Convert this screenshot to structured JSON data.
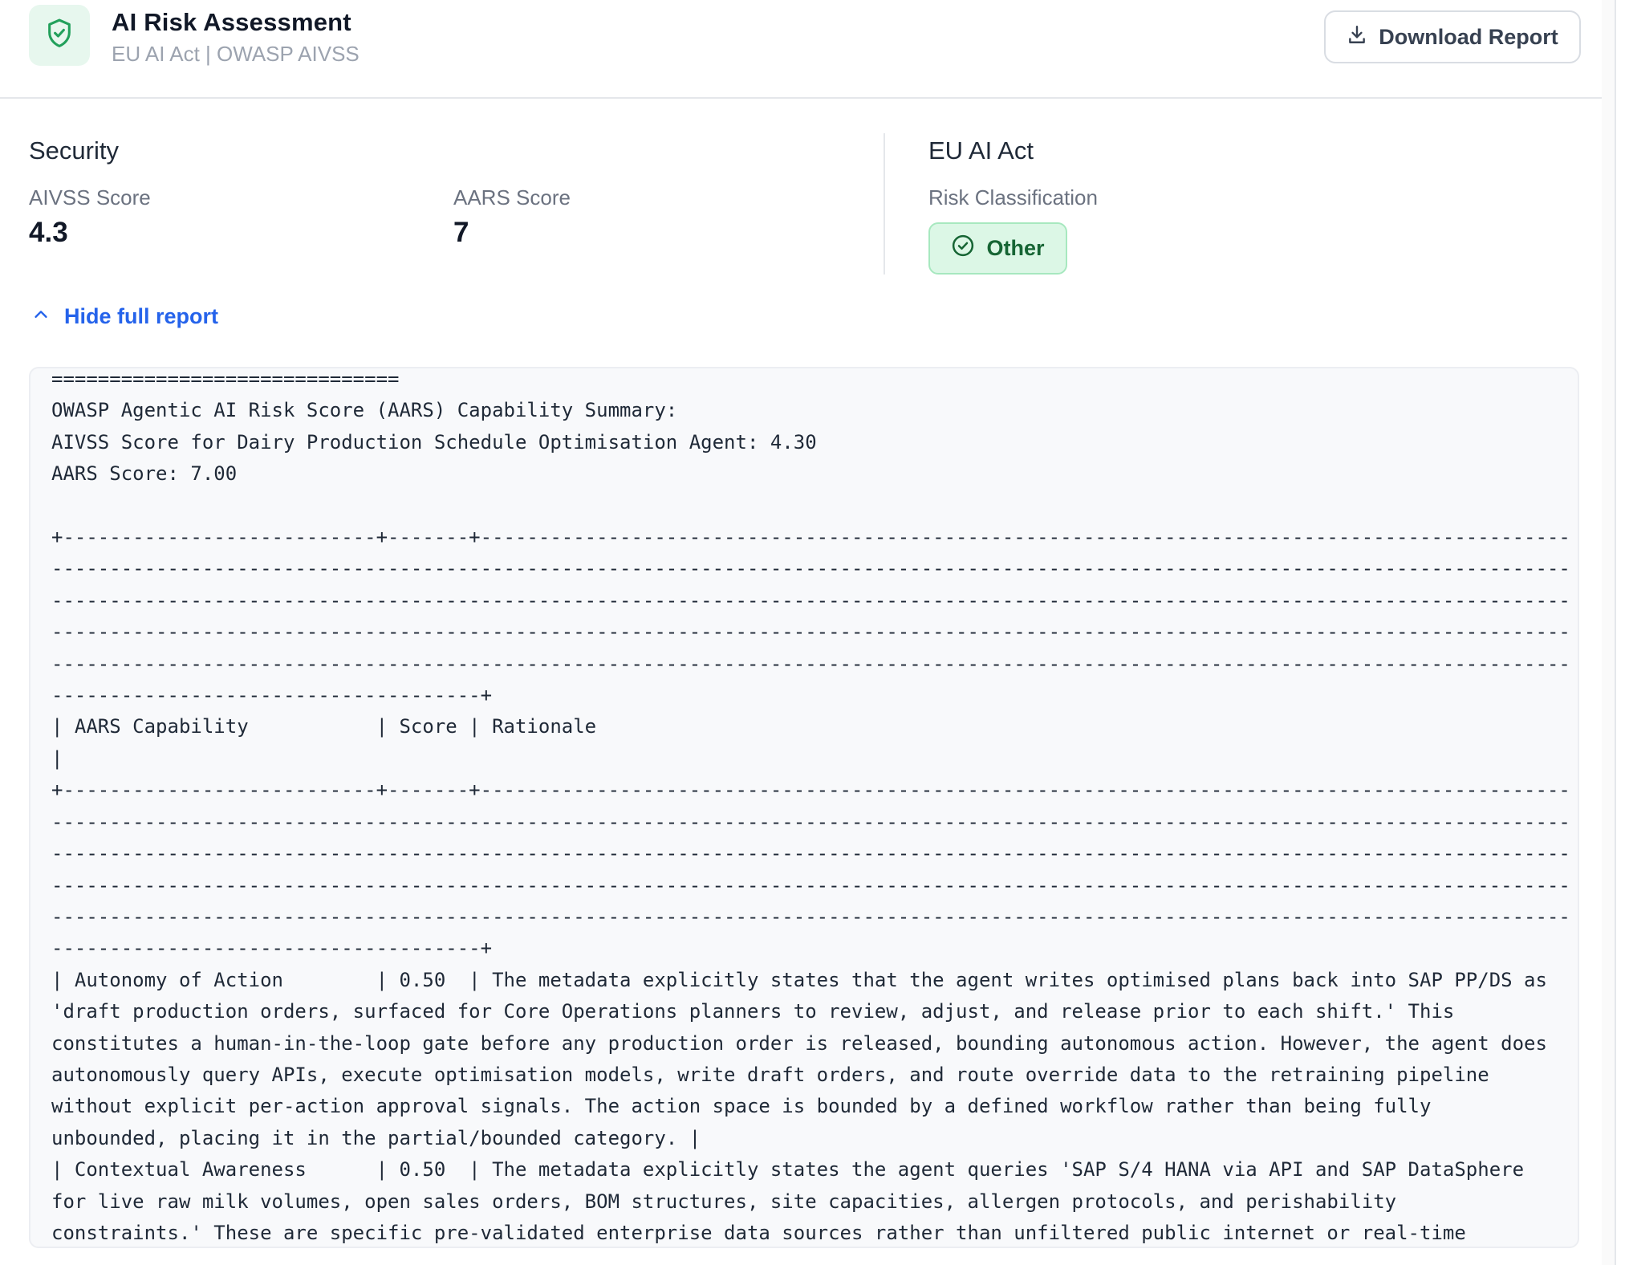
{
  "header": {
    "title": "AI Risk Assessment",
    "subtitle": "EU AI Act | OWASP AIVSS",
    "download_label": "Download Report"
  },
  "security": {
    "title": "Security",
    "aivss_label": "AIVSS Score",
    "aivss_value": "4.3",
    "aars_label": "AARS Score",
    "aars_value": "7"
  },
  "eu_ai_act": {
    "title": "EU AI Act",
    "risk_label": "Risk Classification",
    "risk_value": "Other"
  },
  "report_toggle_label": "Hide full report",
  "report": {
    "lines": [
      "==============================",
      "OWASP Agentic AI Risk Score (AARS) Capability Summary:",
      "AIVSS Score for Dairy Production Schedule Optimisation Agent: 4.30",
      "AARS Score: 7.00",
      "",
      "+---------------------------+-------+-------------------------------------------------------------------------------------------------",
      "----------------------------------------------------------------------------------------------------------------------------------------",
      "----------------------------------------------------------------------------------------------------------------------------------------",
      "----------------------------------------------------------------------------------------------------------------------------------------",
      "----------------------------------------------------------------------------------------------------------------------------------------",
      "-------------------------------------+",
      "| AARS Capability           | Score | Rationale",
      "|",
      "+---------------------------+-------+-------------------------------------------------------------------------------------------------",
      "----------------------------------------------------------------------------------------------------------------------------------------",
      "----------------------------------------------------------------------------------------------------------------------------------------",
      "----------------------------------------------------------------------------------------------------------------------------------------",
      "----------------------------------------------------------------------------------------------------------------------------------------",
      "-------------------------------------+",
      "| Autonomy of Action        | 0.50  | The metadata explicitly states that the agent writes optimised plans back into SAP PP/DS as",
      "'draft production orders, surfaced for Core Operations planners to review, adjust, and release prior to each shift.' This",
      "constitutes a human-in-the-loop gate before any production order is released, bounding autonomous action. However, the agent does",
      "autonomously query APIs, execute optimisation models, write draft orders, and route override data to the retraining pipeline",
      "without explicit per-action approval signals. The action space is bounded by a defined workflow rather than being fully",
      "unbounded, placing it in the partial/bounded category. |",
      "| Contextual Awareness      | 0.50  | The metadata explicitly states the agent queries 'SAP S/4 HANA via API and SAP DataSphere",
      "for live raw milk volumes, open sales orders, BOM structures, site capacities, allergen protocols, and perishability",
      "constraints.' These are specific pre-validated enterprise data sources rather than unfiltered public internet or real-time"
    ]
  }
}
